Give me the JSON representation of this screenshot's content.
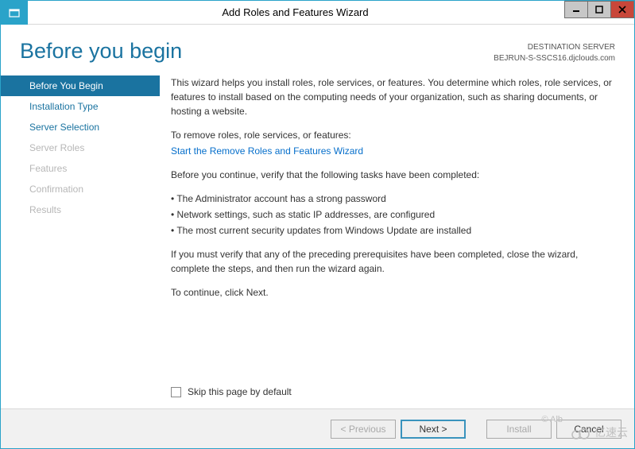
{
  "window": {
    "title": "Add Roles and Features Wizard"
  },
  "header": {
    "page_title": "Before you begin",
    "destination_label": "DESTINATION SERVER",
    "destination_value": "BEJRUN-S-SSCS16.djclouds.com"
  },
  "sidebar": {
    "steps": [
      {
        "label": "Before You Begin",
        "state": "active"
      },
      {
        "label": "Installation Type",
        "state": "enabled"
      },
      {
        "label": "Server Selection",
        "state": "enabled"
      },
      {
        "label": "Server Roles",
        "state": "disabled"
      },
      {
        "label": "Features",
        "state": "disabled"
      },
      {
        "label": "Confirmation",
        "state": "disabled"
      },
      {
        "label": "Results",
        "state": "disabled"
      }
    ]
  },
  "content": {
    "intro": "This wizard helps you install roles, role services, or features. You determine which roles, role services, or features to install based on the computing needs of your organization, such as sharing documents, or hosting a website.",
    "remove_label": "To remove roles, role services, or features:",
    "remove_link": "Start the Remove Roles and Features Wizard",
    "verify_label": "Before you continue, verify that the following tasks have been completed:",
    "bullets": [
      "The Administrator account has a strong password",
      "Network settings, such as static IP addresses, are configured",
      "The most current security updates from Windows Update are installed"
    ],
    "close_note": "If you must verify that any of the preceding prerequisites have been completed, close the wizard, complete the steps, and then run the wizard again.",
    "continue_note": "To continue, click Next.",
    "skip_label": "Skip this page by default",
    "skip_checked": false
  },
  "footer": {
    "previous": "< Previous",
    "next": "Next >",
    "install": "Install",
    "cancel": "Cancel"
  },
  "overlay": {
    "copyright": "© Alb",
    "watermark": "亿速云"
  }
}
